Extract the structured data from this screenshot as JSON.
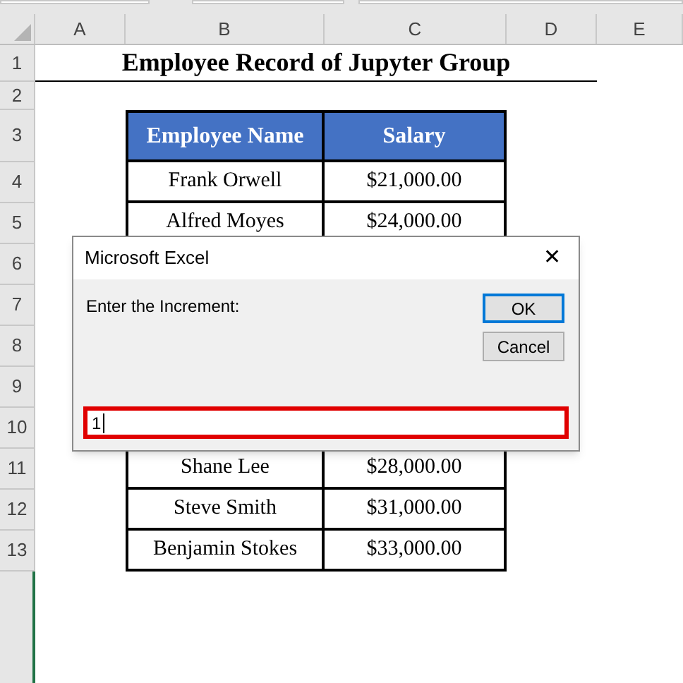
{
  "column_headers": [
    "A",
    "B",
    "C",
    "D",
    "E"
  ],
  "row_headers": [
    "1",
    "2",
    "3",
    "4",
    "5",
    "6",
    "7",
    "8",
    "9",
    "10",
    "11",
    "12",
    "13"
  ],
  "title": "Employee Record of Jupyter Group",
  "table": {
    "columns": [
      "Employee Name",
      "Salary"
    ],
    "rows": [
      [
        "Frank Orwell",
        "$21,000.00"
      ],
      [
        "Alfred Moyes",
        "$24,000.00"
      ],
      [
        "Shane Lee",
        "$28,000.00"
      ],
      [
        "Steve Smith",
        "$31,000.00"
      ],
      [
        "Benjamin Stokes",
        "$33,000.00"
      ]
    ]
  },
  "dialog": {
    "title": "Microsoft Excel",
    "close": "✕",
    "prompt": "Enter the Increment:",
    "buttons": [
      {
        "label": "OK",
        "selected": true
      },
      {
        "label": "Cancel",
        "selected": false
      }
    ],
    "input": {
      "value": "1",
      "highlighted": true
    }
  }
}
